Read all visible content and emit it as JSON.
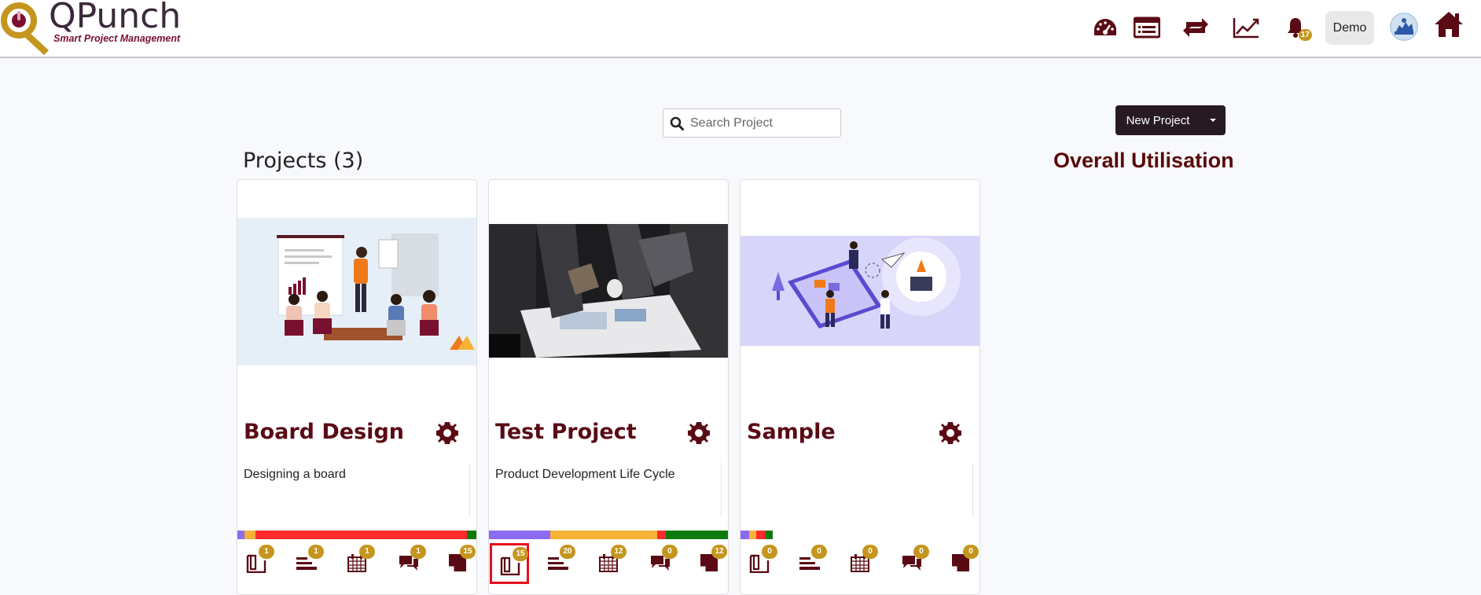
{
  "header": {
    "logo_title": "QPunch",
    "logo_subtitle": "Smart Project Management",
    "notification_count": "17",
    "user_label": "Demo"
  },
  "search": {
    "placeholder": "Search Project"
  },
  "new_project": {
    "label": "New Project"
  },
  "projects_title": "Projects (3)",
  "overall_title": "Overall Utilisation",
  "colors": {
    "brand": "#5a0a14",
    "badge": "#c5961f",
    "button_dark": "#271a24",
    "highlight": "#e3101e"
  },
  "projects": [
    {
      "name": "Board Design",
      "description": "Designing a board",
      "progress": [
        {
          "color": "#8b6cf0",
          "fraction": 0.03
        },
        {
          "color": "#f5b236",
          "fraction": 0.045
        },
        {
          "color": "#ff2a2a",
          "fraction": 0.885
        },
        {
          "color": "#0e7a0e",
          "fraction": 0.04
        }
      ],
      "counts": [
        "1",
        "1",
        "1",
        "1",
        "15"
      ]
    },
    {
      "name": "Test Project",
      "description": "Product Development Life Cycle",
      "progress": [
        {
          "color": "#8b6cf0",
          "fraction": 0.255
        },
        {
          "color": "#f5b236",
          "fraction": 0.45
        },
        {
          "color": "#ff2a2a",
          "fraction": 0.035
        },
        {
          "color": "#0e7a0e",
          "fraction": 0.26
        }
      ],
      "counts": [
        "15",
        "20",
        "12",
        "0",
        "12"
      ]
    },
    {
      "name": "Sample",
      "description": "",
      "progress": [
        {
          "color": "#8b6cf0",
          "fraction": 0.035
        },
        {
          "color": "#f5b236",
          "fraction": 0.03
        },
        {
          "color": "#ff2a2a",
          "fraction": 0.04
        },
        {
          "color": "#0e7a0e",
          "fraction": 0.03
        }
      ],
      "counts": [
        "0",
        "0",
        "0",
        "0",
        "0"
      ]
    }
  ],
  "card_icons": [
    "board-icon",
    "list-icon",
    "calendar-icon",
    "chat-icon",
    "document-icon"
  ]
}
